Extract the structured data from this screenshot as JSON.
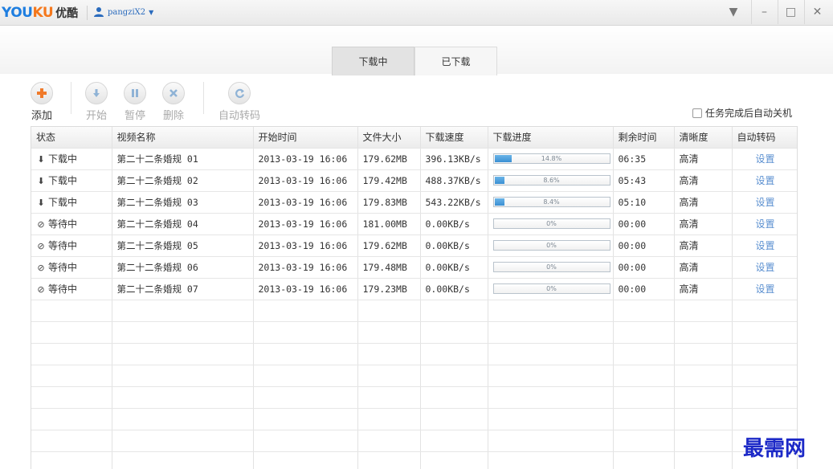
{
  "app": {
    "logo_en_you": "YOU",
    "logo_en_ku": "KU",
    "logo_cn": "优酷",
    "username": "pangziX2"
  },
  "window_controls": [
    {
      "name": "menu",
      "glyph": "▼"
    },
    {
      "name": "minimize",
      "glyph": "–"
    },
    {
      "name": "maximize",
      "glyph": "□"
    },
    {
      "name": "close",
      "glyph": "✕"
    }
  ],
  "tabs": [
    {
      "label": "下载中",
      "active": true
    },
    {
      "label": "已下载",
      "active": false
    }
  ],
  "toolbar": {
    "add_label": "添加",
    "start_label": "开始",
    "pause_label": "暂停",
    "delete_label": "删除",
    "transcode_label": "自动转码",
    "shutdown_label": "任务完成后自动关机",
    "shutdown_checked": false
  },
  "table": {
    "columns": [
      "状态",
      "视频名称",
      "开始时间",
      "文件大小",
      "下载速度",
      "下载进度",
      "剩余时间",
      "清晰度",
      "自动转码"
    ],
    "rows": [
      {
        "status": "下载中",
        "status_icon": "arrow-down",
        "name": "第二十二条婚规 01",
        "start": "2013-03-19 16:06",
        "size": "179.62MB",
        "speed": "396.13KB/s",
        "progress": 14.8,
        "progress_text": "14.8%",
        "remaining": "06:35",
        "quality": "高清",
        "action": "设置"
      },
      {
        "status": "下载中",
        "status_icon": "arrow-down",
        "name": "第二十二条婚规 02",
        "start": "2013-03-19 16:06",
        "size": "179.42MB",
        "speed": "488.37KB/s",
        "progress": 8.6,
        "progress_text": "8.6%",
        "remaining": "05:43",
        "quality": "高清",
        "action": "设置"
      },
      {
        "status": "下载中",
        "status_icon": "arrow-down",
        "name": "第二十二条婚规 03",
        "start": "2013-03-19 16:06",
        "size": "179.83MB",
        "speed": "543.22KB/s",
        "progress": 8.4,
        "progress_text": "8.4%",
        "remaining": "05:10",
        "quality": "高清",
        "action": "设置"
      },
      {
        "status": "等待中",
        "status_icon": "clock",
        "name": "第二十二条婚规 04",
        "start": "2013-03-19 16:06",
        "size": "181.00MB",
        "speed": "0.00KB/s",
        "progress": 0,
        "progress_text": "0%",
        "remaining": "00:00",
        "quality": "高清",
        "action": "设置"
      },
      {
        "status": "等待中",
        "status_icon": "clock",
        "name": "第二十二条婚规 05",
        "start": "2013-03-19 16:06",
        "size": "179.62MB",
        "speed": "0.00KB/s",
        "progress": 0,
        "progress_text": "0%",
        "remaining": "00:00",
        "quality": "高清",
        "action": "设置"
      },
      {
        "status": "等待中",
        "status_icon": "clock",
        "name": "第二十二条婚规 06",
        "start": "2013-03-19 16:06",
        "size": "179.48MB",
        "speed": "0.00KB/s",
        "progress": 0,
        "progress_text": "0%",
        "remaining": "00:00",
        "quality": "高清",
        "action": "设置"
      },
      {
        "status": "等待中",
        "status_icon": "clock",
        "name": "第二十二条婚规 07",
        "start": "2013-03-19 16:06",
        "size": "179.23MB",
        "speed": "0.00KB/s",
        "progress": 0,
        "progress_text": "0%",
        "remaining": "00:00",
        "quality": "高清",
        "action": "设置"
      }
    ]
  },
  "watermark": "最需网",
  "colors": {
    "brand_blue": "#1e7ee0",
    "brand_orange": "#f5781c",
    "link": "#5a8fd0",
    "progress": "#3a8fd3",
    "watermark": "#1c29c7"
  }
}
